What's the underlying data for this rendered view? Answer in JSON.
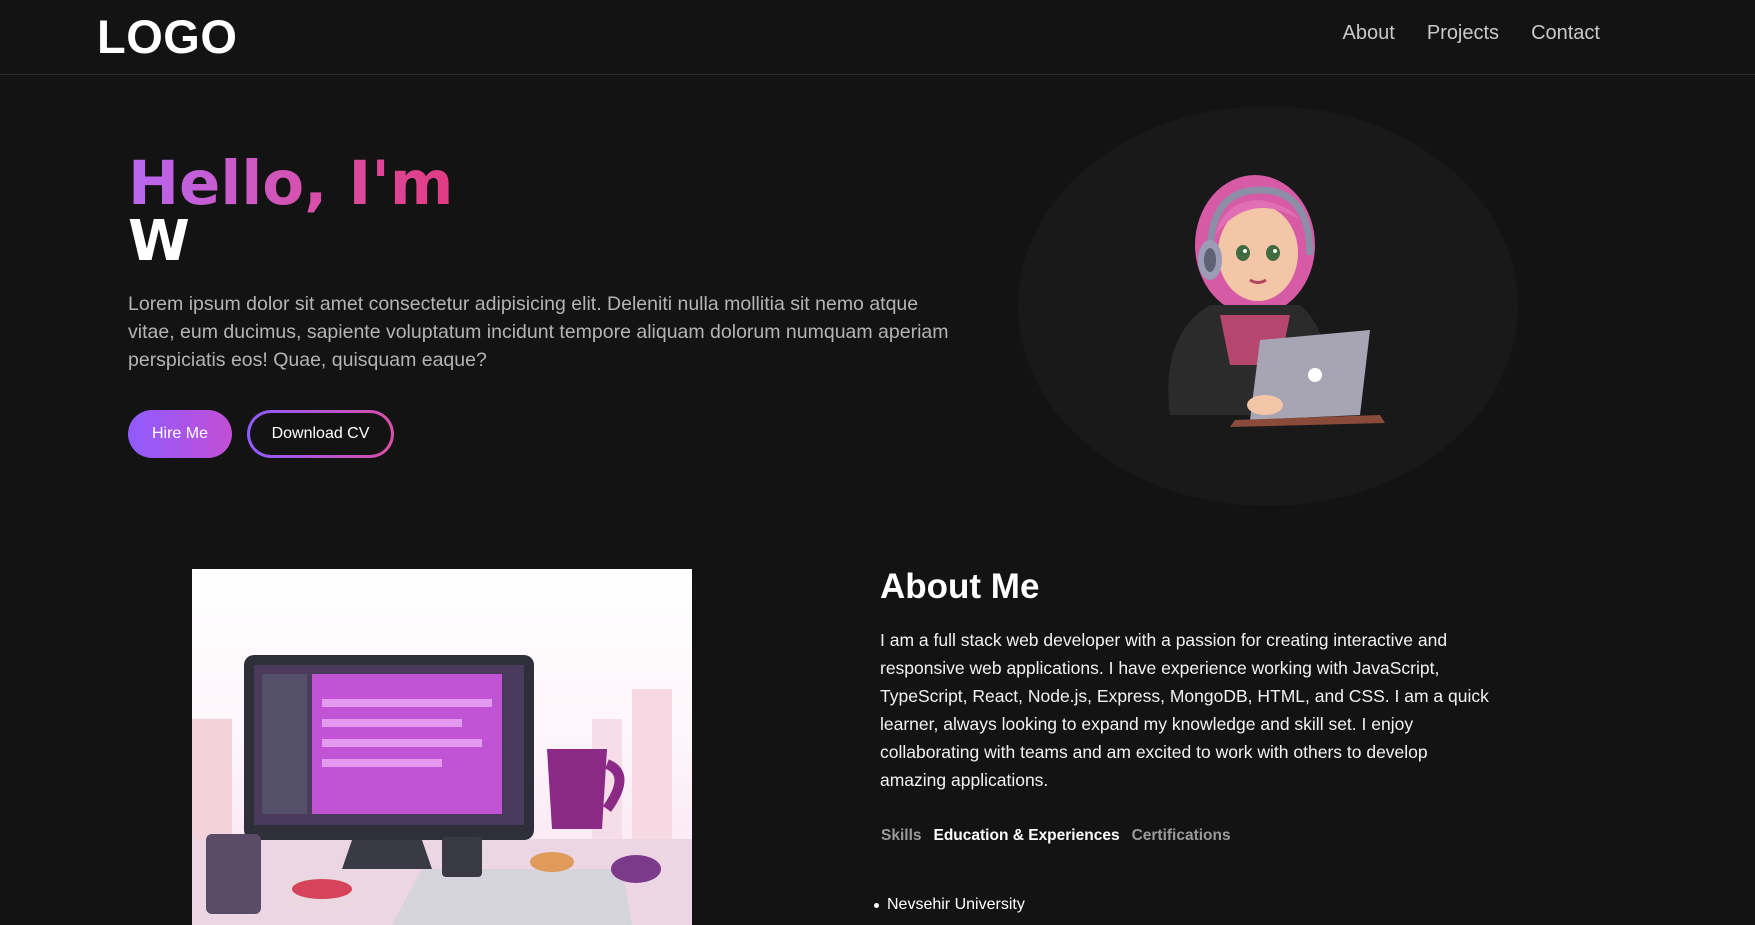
{
  "nav": {
    "logo": "LOGO",
    "links": [
      "About",
      "Projects",
      "Contact"
    ]
  },
  "hero": {
    "greeting": "Hello, I'm",
    "name": "W",
    "description": "Lorem ipsum dolor sit amet consectetur adipisicing elit. Deleniti nulla mollitia sit nemo atque vitae, eum ducimus, sapiente voluptatum incidunt tempore aliquam dolorum numquam aperiam perspiciatis eos! Quae, quisquam eaque?",
    "hire_label": "Hire Me",
    "cv_label": "Download CV"
  },
  "about": {
    "title": "About Me",
    "text": "I am a full stack web developer with a passion for creating interactive and responsive web applications. I have experience working with JavaScript, TypeScript, React, Node.js, Express, MongoDB, HTML, and CSS. I am a quick learner, always looking to expand my knowledge and skill set. I enjoy collaborating with teams and am excited to work with others to develop amazing applications.",
    "tabs": [
      "Skills",
      "Education & Experiences",
      "Certifications"
    ],
    "active_tab": "Education & Experiences",
    "education": [
      "Nevsehir University"
    ]
  },
  "colors": {
    "background": "#131313",
    "accent_purple": "#8f5bff",
    "accent_pink": "#d94fa6"
  },
  "icons": {
    "avatar": "girl-with-laptop-illustration",
    "about_image": "desk-computer-illustration"
  }
}
